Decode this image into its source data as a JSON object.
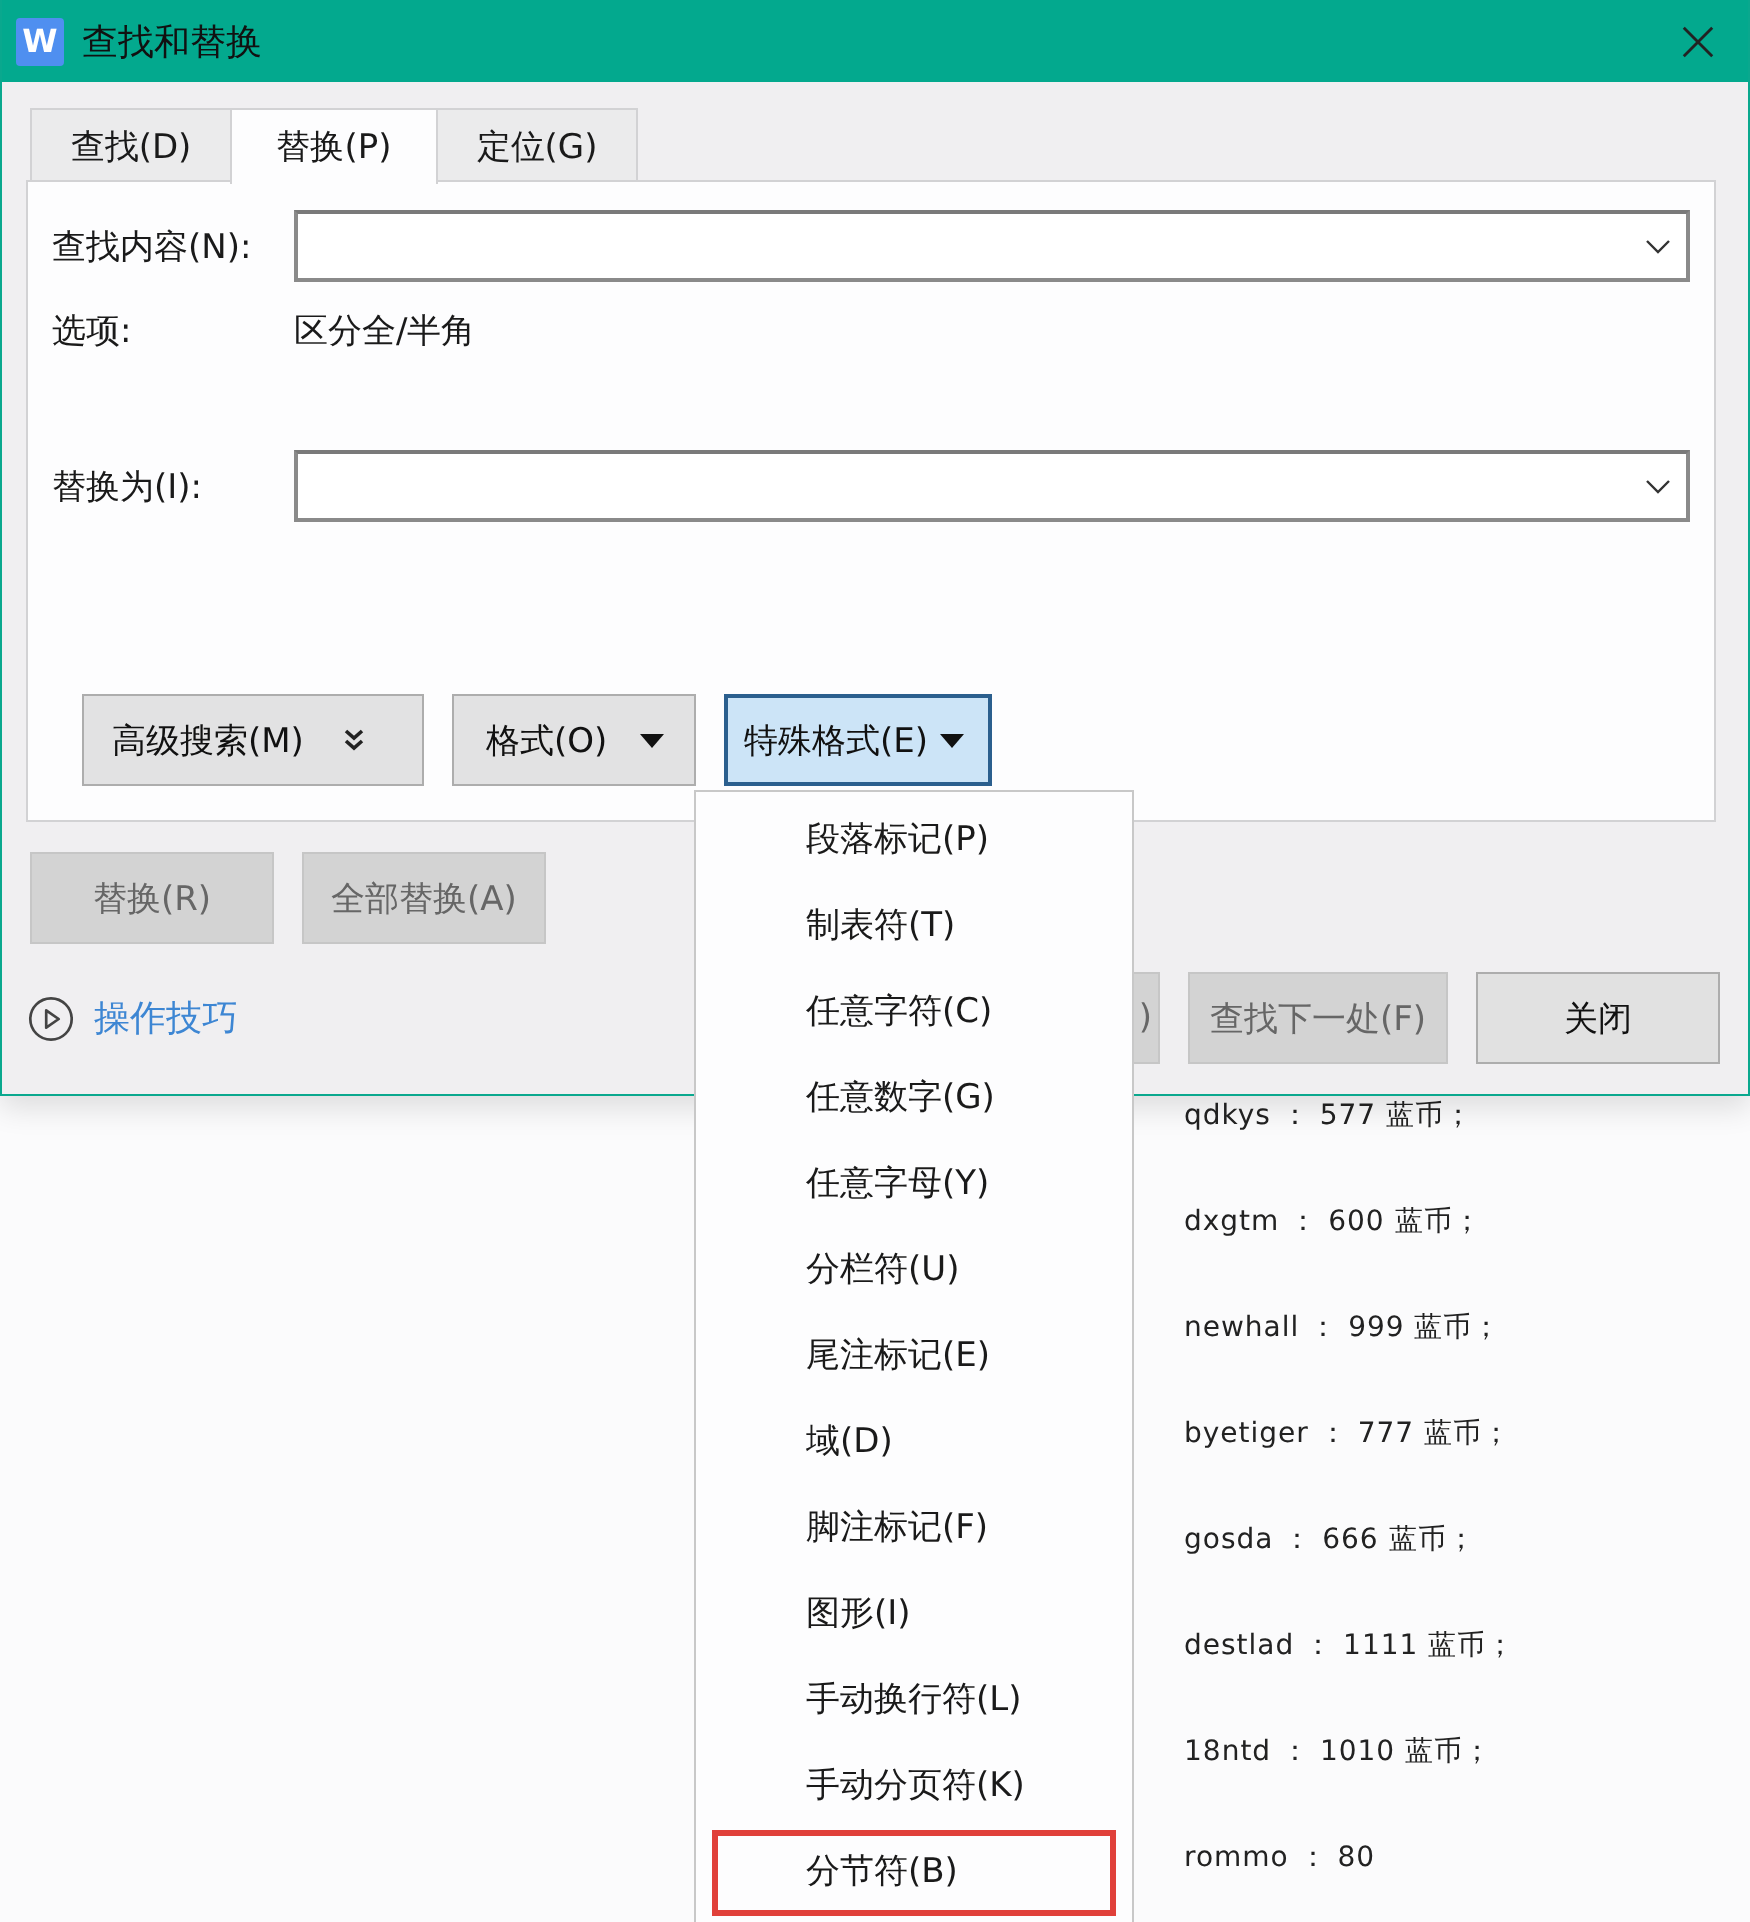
{
  "window": {
    "app_logo": "W",
    "title": "查找和替换"
  },
  "tabs": [
    {
      "label": "查找(D)",
      "selected": false
    },
    {
      "label": "替换(P)",
      "selected": true
    },
    {
      "label": "定位(G)",
      "selected": false
    }
  ],
  "find": {
    "label": "查找内容(N):"
  },
  "options": {
    "label": "选项:",
    "value": "区分全/半角"
  },
  "replace": {
    "label": "替换为(I):"
  },
  "format_buttons": [
    {
      "label": "高级搜索(M)",
      "kind": "expander",
      "pressed": false
    },
    {
      "label": "格式(O)",
      "kind": "dropdown",
      "pressed": false
    },
    {
      "label": "特殊格式(E)",
      "kind": "dropdown",
      "pressed": true
    }
  ],
  "action_buttons": [
    {
      "label": "替换(R)",
      "disabled": true
    },
    {
      "label": "全部替换(A)",
      "disabled": true
    }
  ],
  "tips_link": "操作技巧",
  "footer_buttons": [
    {
      "label": ")",
      "disabled": true
    },
    {
      "label": "查找下一处(F)",
      "disabled": true
    },
    {
      "label": "关闭",
      "disabled": false
    }
  ],
  "special_menu": {
    "items": [
      {
        "label": "段落标记(P)",
        "highlighted": false
      },
      {
        "label": "制表符(T)",
        "highlighted": false
      },
      {
        "label": "任意字符(C)",
        "highlighted": false
      },
      {
        "label": "任意数字(G)",
        "highlighted": false
      },
      {
        "label": "任意字母(Y)",
        "highlighted": false
      },
      {
        "label": "分栏符(U)",
        "highlighted": false
      },
      {
        "label": "尾注标记(E)",
        "highlighted": false
      },
      {
        "label": "域(D)",
        "highlighted": false
      },
      {
        "label": "脚注标记(F)",
        "highlighted": false
      },
      {
        "label": "图形(I)",
        "highlighted": false
      },
      {
        "label": "手动换行符(L)",
        "highlighted": false
      },
      {
        "label": "手动分页符(K)",
        "highlighted": false
      },
      {
        "label": "分节符(B)",
        "highlighted": true
      }
    ]
  },
  "document": {
    "lines": [
      "qdkys ： 577 蓝币；",
      "dxgtm ： 600 蓝币；",
      "newhall ： 999 蓝币；",
      "byetiger ： 777 蓝币；",
      "gosda ： 666 蓝币；",
      "destlad ： 1111 蓝币；",
      "18ntd ： 1010 蓝币；",
      "rommo ： 80"
    ]
  }
}
